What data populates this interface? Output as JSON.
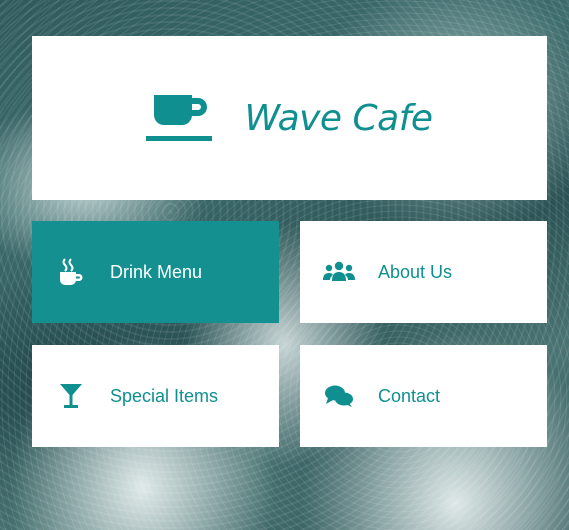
{
  "brand": {
    "name": "Wave Cafe",
    "accent": "#149090"
  },
  "nav": {
    "items": [
      {
        "label": "Drink Menu",
        "icon": "coffee-mug-icon",
        "active": true
      },
      {
        "label": "About Us",
        "icon": "users-icon",
        "active": false
      },
      {
        "label": "Special Items",
        "icon": "cocktail-icon",
        "active": false
      },
      {
        "label": "Contact",
        "icon": "comments-icon",
        "active": false
      }
    ]
  }
}
